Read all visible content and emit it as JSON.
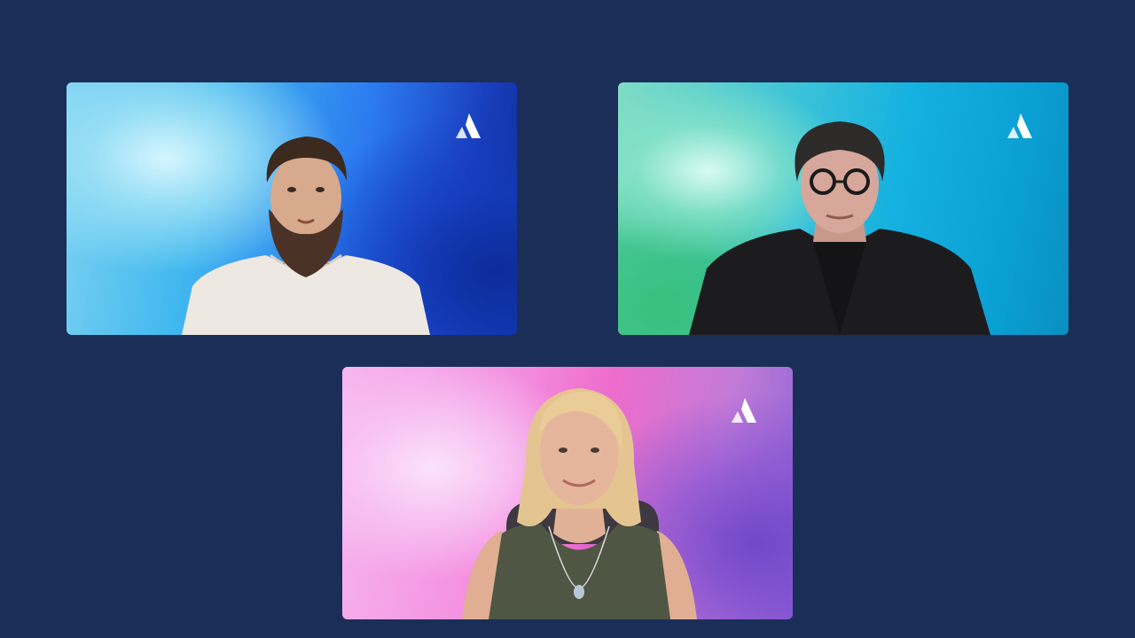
{
  "meeting": {
    "participants": [
      {
        "id": "participant-1",
        "background": "blue",
        "brand_logo": "atlassian-logo-icon"
      },
      {
        "id": "participant-2",
        "background": "teal-green",
        "brand_logo": "atlassian-logo-icon"
      },
      {
        "id": "participant-3",
        "background": "pink-purple",
        "brand_logo": "atlassian-logo-icon"
      }
    ]
  },
  "colors": {
    "page_background": "#1b2e57",
    "logo": "#ffffff"
  }
}
